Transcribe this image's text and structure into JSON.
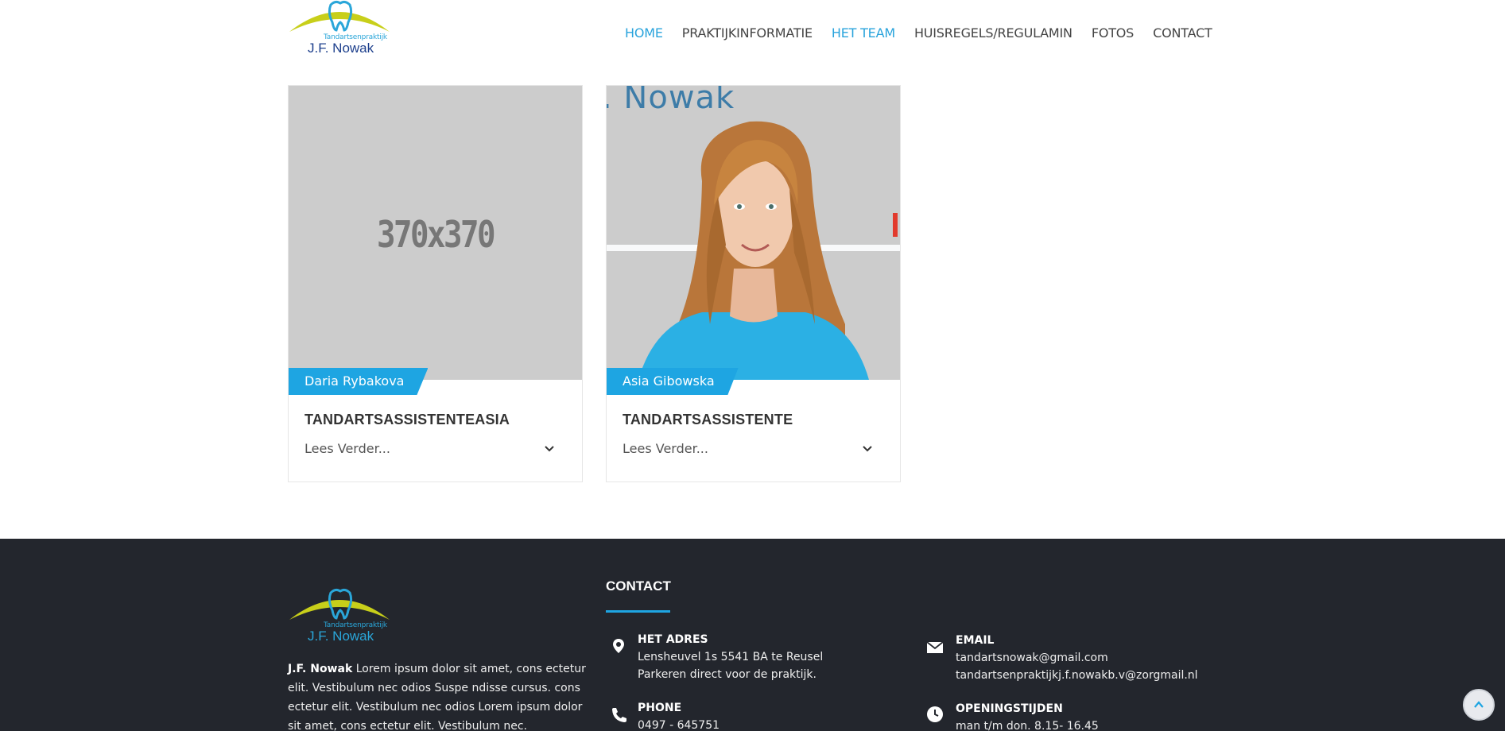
{
  "brand": {
    "logo_small": "Tandartsenpraktijk",
    "logo_name": "J.F. Nowak"
  },
  "nav": {
    "items": [
      {
        "label": "HOME",
        "active": true
      },
      {
        "label": "PRAKTIJKINFORMATIE",
        "active": false
      },
      {
        "label": "HET TEAM",
        "active": true
      },
      {
        "label": "HUISREGELS/REGULAMIN",
        "active": false
      },
      {
        "label": "FOTOS",
        "active": false
      },
      {
        "label": "CONTACT",
        "active": false
      }
    ]
  },
  "team": [
    {
      "name": "Daria Rybakova",
      "role": "TANDARTSASSISTENTEASIA",
      "more": "Lees Verder...",
      "placeholder": "370x370"
    },
    {
      "name": "Asia Gibowska",
      "role": "TANDARTSASSISTENTE",
      "more": "Lees Verder...",
      "photo_brand": ". Nowak"
    }
  ],
  "footer": {
    "about_name": "J.F. Nowak",
    "about_text": "Lorem ipsum dolor sit amet, cons ectetur elit. Vestibulum nec odios Suspe ndisse cursus. cons ectetur elit. Vestibulum nec odios Lorem ipsum dolor sit amet, cons ectetur elit. Vestibulum nec.",
    "contact_title": "CONTACT",
    "address_head": "HET ADRES",
    "address_line1": "Lensheuvel 1s 5541 BA te Reusel",
    "address_line2": "Parkeren direct voor de praktijk.",
    "email_head": "EMAIL",
    "email_line1": "tandartsnowak@gmail.com",
    "email_line2": "tandartsenpraktijkj.f.nowakb.v@zorgmail.nl",
    "phone_head": "PHONE",
    "phone_line1": "0497 - 645751",
    "hours_head": "OPENINGSTIJDEN",
    "hours_line1": "man t/m don. 8.15- 16.45"
  },
  "colors": {
    "accent": "#1ea5e2",
    "nav_active": "#29a3dc",
    "footer_bg": "#23262d",
    "logo_yellow": "#c8cf1a",
    "logo_blue": "#1d3f8c"
  }
}
